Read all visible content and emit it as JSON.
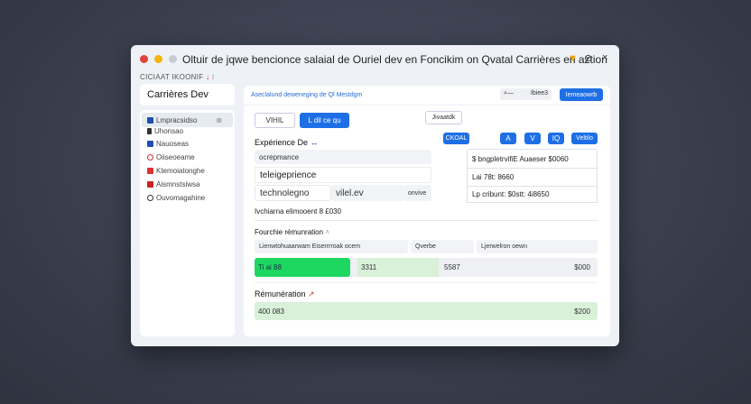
{
  "window": {
    "title": "Oltuir de jqwe bencionce salaial de Ouriel dev en Foncikim on Qvatal Carrières en aztion",
    "subtitle": "CICIAAT IKOONIF"
  },
  "sidebar": {
    "brand": "Carrières Dev",
    "items": [
      {
        "label": "Lmpracsidso",
        "icon": "user-icon"
      },
      {
        "label": "Uhonsao",
        "icon": "pin-icon"
      },
      {
        "label": "Nauoseas",
        "icon": "grid-icon"
      },
      {
        "label": "Oiiseoeame",
        "icon": "search-icon"
      },
      {
        "label": "Ktemoiatonghe",
        "icon": "tag-icon"
      },
      {
        "label": "Aismnstsiwsa",
        "icon": "briefcase-icon"
      },
      {
        "label": "Ouvomagahine",
        "icon": "globe-icon"
      }
    ]
  },
  "header": {
    "breadcrumb": "Aseclalund deweneging de Ql Mestdgm",
    "search_value": "Ibiee3",
    "action_label": "Iemeaowrb"
  },
  "toolbar": {
    "tab1": "VIHIL",
    "tab2": "L dil ce qu",
    "filter_label": "Jivaatdk",
    "icon_buttons": [
      "CKOAL",
      "A",
      "V",
      "IQ",
      "Veltilo"
    ]
  },
  "experience": {
    "title": "Expérience De",
    "field1": "ocrepmance",
    "field2": "teleigeprience",
    "field3": "technolegno",
    "field4": "vilel.ev",
    "field5": "onvive",
    "note": "Ivchiarna elimooent 8 £030"
  },
  "summary": {
    "line1": "$ bngpletrvifiE Auaeser $0060",
    "line2": "Lai 78t: 8660",
    "line3": "Lp cribunt: $0stt: 4i8650"
  },
  "fourchette": {
    "title": "Fourchie rémunration",
    "tabs": [
      "Lienwtohuaarwam Eiserrrroak ocem",
      "Qverbe",
      "Ljerwelron oewn"
    ],
    "bar": {
      "seg1": "Ti ai 88",
      "seg2": "3311",
      "seg3": "5587",
      "max": "$000"
    },
    "fill_fraction": 0.28
  },
  "remuneration": {
    "title": "Rémunération",
    "min": "400 083",
    "max": "$200"
  }
}
